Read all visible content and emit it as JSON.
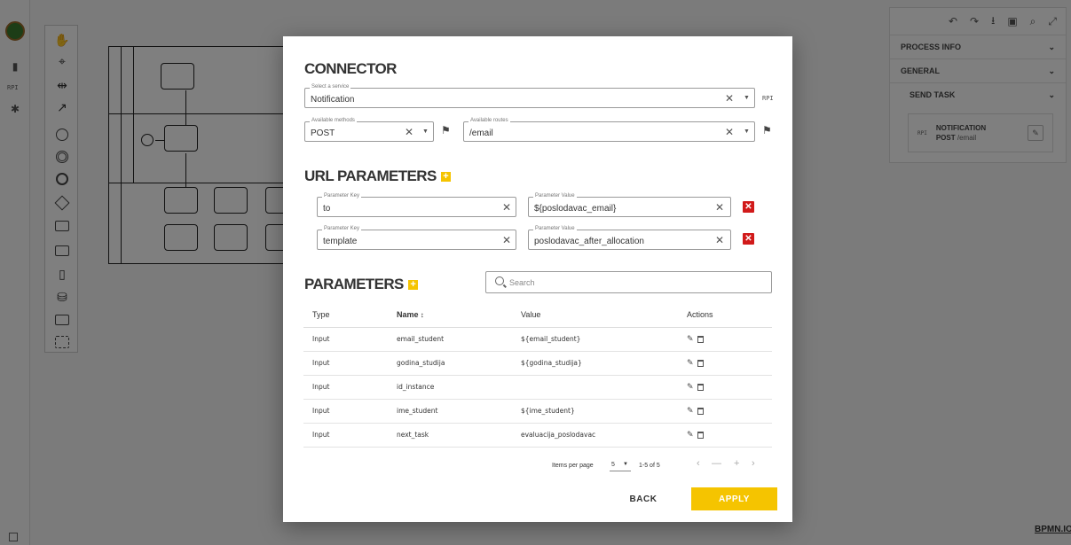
{
  "background": {
    "rail_label": "RPI",
    "right_panel": {
      "process_info": "PROCESS INFO",
      "general": "GENERAL",
      "send_task": "SEND TASK",
      "card_rpi": "RPI",
      "card_title": "NOTIFICATION",
      "card_method": "POST",
      "card_route": "/email"
    },
    "bpmn_io": "BPMN.IO"
  },
  "connector": {
    "title": "CONNECTOR",
    "service_label": "Select a service",
    "service_value": "Notification",
    "service_suffix": "RPI",
    "methods_label": "Available methods",
    "methods_value": "POST",
    "routes_label": "Available routes",
    "routes_value": "/email"
  },
  "url_parameters": {
    "title": "URL PARAMETERS",
    "key_label": "Parameter Key",
    "value_label": "Parameter Value",
    "rows": [
      {
        "key": "to",
        "value": "${poslodavac_email}"
      },
      {
        "key": "template",
        "value": "poslodavac_after_allocation"
      }
    ]
  },
  "parameters": {
    "title": "PARAMETERS",
    "search_placeholder": "Search",
    "columns": {
      "type": "Type",
      "name": "Name",
      "value": "Value",
      "actions": "Actions"
    },
    "rows": [
      {
        "type": "Input",
        "name": "email_student",
        "value": "${email_student}"
      },
      {
        "type": "Input",
        "name": "godina_studija",
        "value": "${godina_studija}"
      },
      {
        "type": "Input",
        "name": "id_instance",
        "value": ""
      },
      {
        "type": "Input",
        "name": "ime_student",
        "value": "${ime_student}"
      },
      {
        "type": "Input",
        "name": "next_task",
        "value": "evaluacija_poslodavac"
      }
    ],
    "pagination": {
      "items_per_page_label": "Items per page",
      "items_per_page": "5",
      "range": "1-5 of 5"
    }
  },
  "buttons": {
    "back": "BACK",
    "apply": "APPLY"
  },
  "colors": {
    "accent": "#f5c400",
    "delete": "#d11a1a"
  }
}
